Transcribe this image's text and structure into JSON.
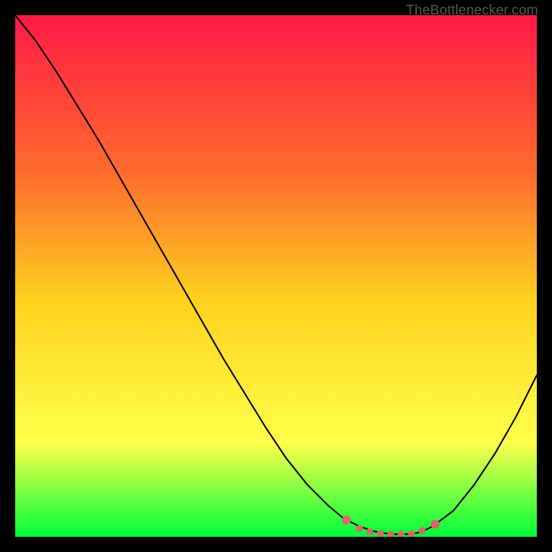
{
  "watermark": "TheBottlenecker.com",
  "gradient": {
    "top": "#ff1a47",
    "q1": "#ff6a2c",
    "mid": "#ffd21f",
    "q3": "#ffff4a",
    "bottom": "#00ff3a"
  },
  "colors": {
    "curve": "#000000",
    "markers": "#d46a6a",
    "frame": "#000000"
  },
  "chart_data": {
    "type": "line",
    "title": "",
    "xlabel": "",
    "ylabel": "",
    "xlim": [
      0,
      100
    ],
    "ylim": [
      0,
      100
    ],
    "x": [
      0,
      4,
      8,
      12,
      16,
      20,
      24,
      28,
      32,
      36,
      40,
      44,
      48,
      52,
      56,
      60,
      63,
      66,
      69,
      72,
      74,
      76,
      78,
      80,
      84,
      88,
      92,
      96,
      100
    ],
    "values": [
      100,
      95,
      89,
      82.5,
      76,
      69,
      62,
      55,
      48,
      41,
      34,
      27.5,
      21,
      15,
      10,
      6,
      3.5,
      2,
      1,
      0.5,
      0.5,
      0.5,
      1,
      2,
      5,
      10,
      16,
      23,
      31
    ],
    "markers_x": [
      63.5,
      66,
      68,
      70,
      72,
      74,
      76,
      78,
      80.5
    ],
    "markers_y": [
      3.2,
      1.6,
      1.0,
      0.6,
      0.5,
      0.5,
      0.6,
      1.2,
      2.4
    ]
  }
}
